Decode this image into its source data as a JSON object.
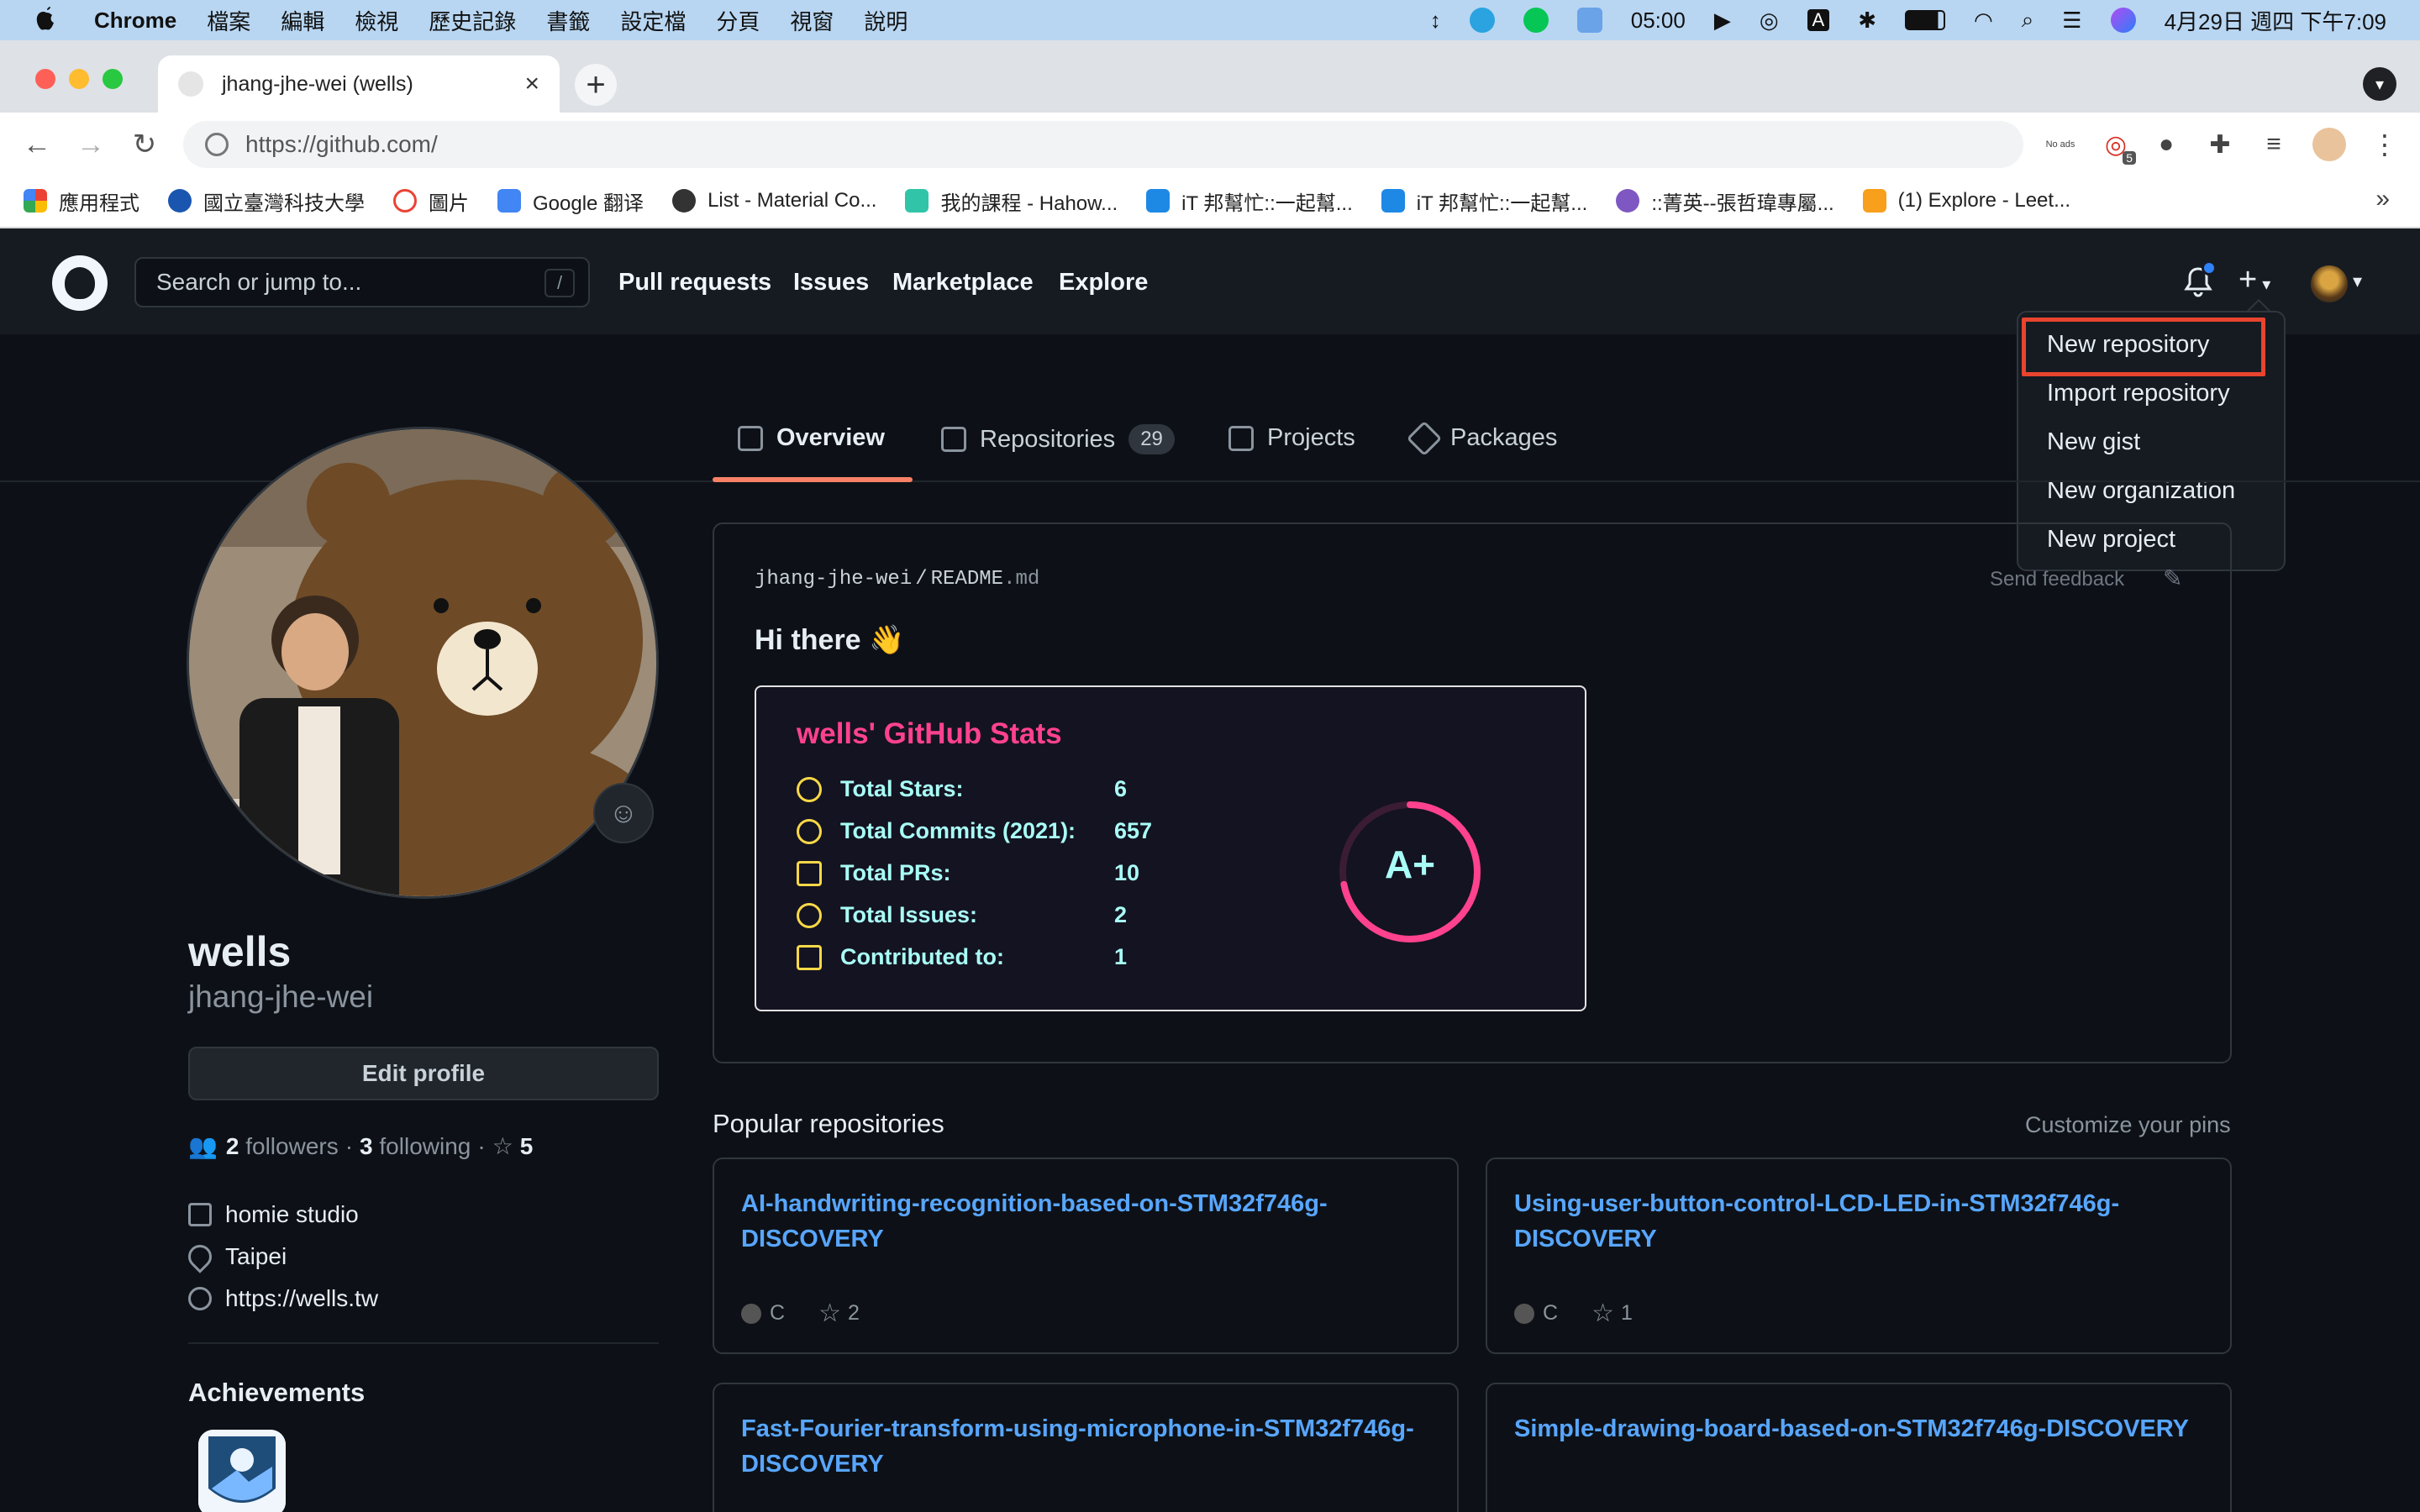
{
  "macos": {
    "app_name": "Chrome",
    "menus": [
      "檔案",
      "編輯",
      "檢視",
      "歷史記錄",
      "書籤",
      "設定檔",
      "分頁",
      "視窗",
      "說明"
    ],
    "clock_timer": "05:00",
    "datetime": "4月29日 週四 下午7:09",
    "input_indicator": "A"
  },
  "browser": {
    "tab_title": "jhang-jhe-wei (wells)",
    "url": "https://github.com/",
    "ext_badge": "5",
    "ext_noads": "No ads",
    "bookmarks": [
      {
        "label": "應用程式",
        "color": "#4285f4"
      },
      {
        "label": "國立臺灣科技大學",
        "color": "#1a56b0"
      },
      {
        "label": "圖片",
        "color": "#ea4335"
      },
      {
        "label": "Google 翻译",
        "color": "#4285f4"
      },
      {
        "label": "List - Material Co...",
        "color": "#333333"
      },
      {
        "label": "我的課程 - Hahow...",
        "color": "#31c4a8"
      },
      {
        "label": "iT 邦幫忙::一起幫...",
        "color": "#1e88e5"
      },
      {
        "label": "iT 邦幫忙::一起幫...",
        "color": "#1e88e5"
      },
      {
        "label": "::菁英--張哲瑋專屬...",
        "color": "#7e57c2"
      },
      {
        "label": "(1) Explore - Leet...",
        "color": "#f89f1b"
      }
    ]
  },
  "github": {
    "search_placeholder": "Search or jump to...",
    "search_key": "/",
    "nav": [
      "Pull requests",
      "Issues",
      "Marketplace",
      "Explore"
    ],
    "dropdown": [
      "New repository",
      "Import repository",
      "New gist",
      "New organization",
      "New project"
    ],
    "tabs": {
      "overview": "Overview",
      "repositories": "Repositories",
      "repositories_count": "29",
      "projects": "Projects",
      "packages": "Packages"
    },
    "profile": {
      "name": "wells",
      "login": "jhang-jhe-wei",
      "edit_button": "Edit profile",
      "followers": "2",
      "followers_label": "followers",
      "following": "3",
      "following_label": "following",
      "stars": "5",
      "company": "homie studio",
      "location": "Taipei",
      "website": "https://wells.tw",
      "achievements_title": "Achievements"
    },
    "readme": {
      "user": "jhang-jhe-wei",
      "file": "README",
      "ext": ".md",
      "send_feedback": "Send feedback",
      "greeting": "Hi there 👋"
    },
    "stats_card": {
      "title": "wells' GitHub Stats",
      "rows": [
        {
          "label": "Total Stars:",
          "value": "6"
        },
        {
          "label": "Total Commits (2021):",
          "value": "657"
        },
        {
          "label": "Total PRs:",
          "value": "10"
        },
        {
          "label": "Total Issues:",
          "value": "2"
        },
        {
          "label": "Contributed to:",
          "value": "1"
        }
      ],
      "grade": "A+",
      "grade_progress": 0.72,
      "colors": {
        "title": "#fe428e",
        "text": "#a9fef7",
        "icon": "#f8d847",
        "bg": "#141321"
      }
    },
    "popular": {
      "title": "Popular repositories",
      "customize": "Customize your pins",
      "repos": [
        {
          "name": "AI-handwriting-recognition-based-on-STM32f746g-DISCOVERY",
          "lang": "C",
          "stars": "2"
        },
        {
          "name": "Using-user-button-control-LCD-LED-in-STM32f746g-DISCOVERY",
          "lang": "C",
          "stars": "1"
        },
        {
          "name": "Fast-Fourier-transform-using-microphone-in-STM32f746g-DISCOVERY",
          "lang": "",
          "stars": ""
        },
        {
          "name": "Simple-drawing-board-based-on-STM32f746g-DISCOVERY",
          "lang": "",
          "stars": ""
        }
      ]
    },
    "accent": {
      "link": "#58a6ff",
      "tab_underline": "#f78166",
      "highlight_box": "#e8442e"
    }
  }
}
